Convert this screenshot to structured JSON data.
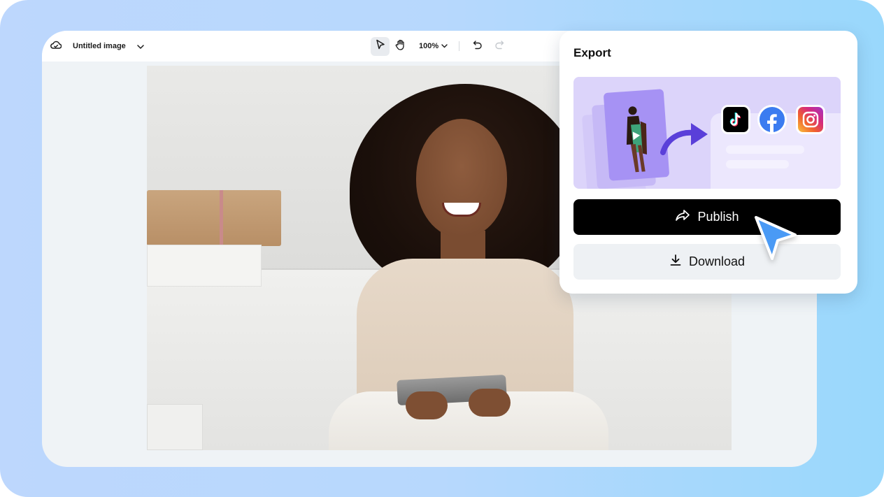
{
  "editor": {
    "title": "Untitled image",
    "title_icon": "cloud-check-icon",
    "toolbar": {
      "select_tool": "pointer-icon",
      "hand_tool": "hand-icon",
      "zoom_level": "100%",
      "undo": "undo-icon",
      "redo": "redo-icon"
    },
    "canvas": {
      "image_description": "Smiling woman with curly hair sitting cross-legged holding a tablet"
    }
  },
  "export_panel": {
    "title": "Export",
    "promo": {
      "platforms": [
        "TikTok",
        "Facebook",
        "Instagram"
      ]
    },
    "publish_label": "Publish",
    "download_label": "Download"
  },
  "colors": {
    "publish_bg": "#000000",
    "download_bg": "#eef1f4",
    "promo_bg": "#dcd4fa",
    "cursor": "#4a9af5",
    "background_left": "#bdd7fd",
    "background_right": "#99d8fc"
  }
}
